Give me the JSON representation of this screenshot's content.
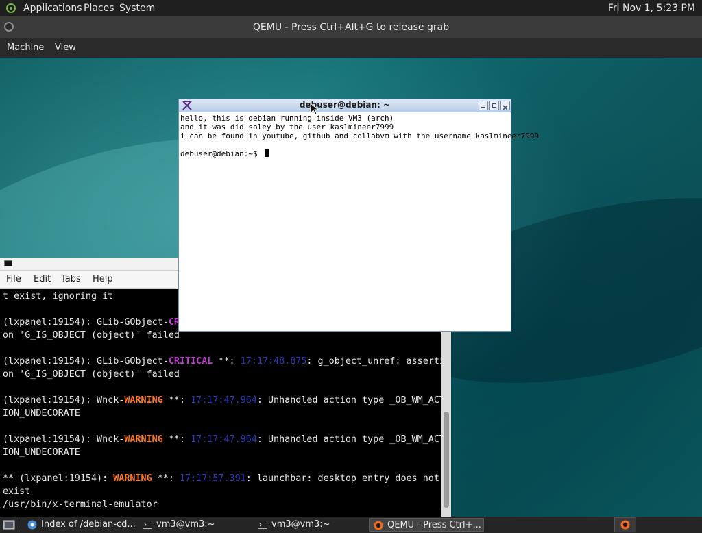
{
  "top_panel": {
    "menus": [
      "Applications",
      "Places",
      "System"
    ],
    "clock": "Fri Nov  1,  5:23 PM"
  },
  "qemu": {
    "title": "QEMU - Press Ctrl+Alt+G to release grab",
    "menu": [
      "Machine",
      "View"
    ]
  },
  "xterm": {
    "title": "debuser@debian: ~",
    "lines": [
      "hello, this is debian running inside VM3 (arch)",
      "and it was did soley by the user kaslmineer7999",
      "i can be found in youtube, github and collabvm with the username kaslmineer7999",
      ""
    ],
    "prompt": "debuser@debian:~$ "
  },
  "lxterminal": {
    "menu": [
      "File",
      "Edit",
      "Tabs",
      "Help"
    ],
    "lines": [
      {
        "segments": [
          {
            "t": "t exist, ignoring it"
          }
        ]
      },
      {
        "segments": [
          {
            "t": ""
          }
        ]
      },
      {
        "segments": [
          {
            "t": "(lxpanel:19154): GLib-GObject-"
          },
          {
            "t": "CRI",
            "c": "critical"
          }
        ]
      },
      {
        "segments": [
          {
            "t": "on 'G_IS_OBJECT (object)' failed"
          }
        ]
      },
      {
        "segments": [
          {
            "t": ""
          }
        ]
      },
      {
        "segments": [
          {
            "t": "(lxpanel:19154): GLib-GObject-"
          },
          {
            "t": "CRITICAL",
            "c": "critical"
          },
          {
            "t": " **: "
          },
          {
            "t": "17:17:48.875",
            "c": "time"
          },
          {
            "t": ": g_object_unref: asserti"
          }
        ]
      },
      {
        "segments": [
          {
            "t": "on 'G_IS_OBJECT (object)' failed"
          }
        ]
      },
      {
        "segments": [
          {
            "t": ""
          }
        ]
      },
      {
        "segments": [
          {
            "t": "(lxpanel:19154): Wnck-"
          },
          {
            "t": "WARNING",
            "c": "warning"
          },
          {
            "t": " **: "
          },
          {
            "t": "17:17:47.964",
            "c": "time"
          },
          {
            "t": ": Unhandled action type _OB_WM_ACT"
          }
        ]
      },
      {
        "segments": [
          {
            "t": "ION_UNDECORATE"
          }
        ]
      },
      {
        "segments": [
          {
            "t": ""
          }
        ]
      },
      {
        "segments": [
          {
            "t": "(lxpanel:19154): Wnck-"
          },
          {
            "t": "WARNING",
            "c": "warning"
          },
          {
            "t": " **: "
          },
          {
            "t": "17:17:47.964",
            "c": "time"
          },
          {
            "t": ": Unhandled action type _OB_WM_ACT"
          }
        ]
      },
      {
        "segments": [
          {
            "t": "ION_UNDECORATE"
          }
        ]
      },
      {
        "segments": [
          {
            "t": ""
          }
        ]
      },
      {
        "segments": [
          {
            "t": "** (lxpanel:19154): "
          },
          {
            "t": "WARNING",
            "c": "warning"
          },
          {
            "t": " **: "
          },
          {
            "t": "17:17:57.391",
            "c": "time"
          },
          {
            "t": ": launchbar: desktop entry does not"
          }
        ]
      },
      {
        "segments": [
          {
            "t": "exist"
          }
        ]
      },
      {
        "segments": [
          {
            "t": "/usr/bin/x-terminal-emulator"
          }
        ]
      }
    ]
  },
  "taskbar": {
    "tasks": [
      {
        "label": "Index of /debian-cd...",
        "icon": "chromium-icon",
        "active": false
      },
      {
        "label": "vm3@vm3:~",
        "icon": "terminal-icon",
        "active": false
      },
      {
        "label": "vm3@vm3:~",
        "icon": "terminal-icon",
        "active": false
      },
      {
        "label": "QEMU - Press Ctrl+...",
        "icon": "qemu-icon",
        "active": true
      }
    ]
  },
  "colors": {
    "critical": "#c13ad1",
    "warning": "#ff7a21",
    "timestamp": "#2b3cbf"
  }
}
